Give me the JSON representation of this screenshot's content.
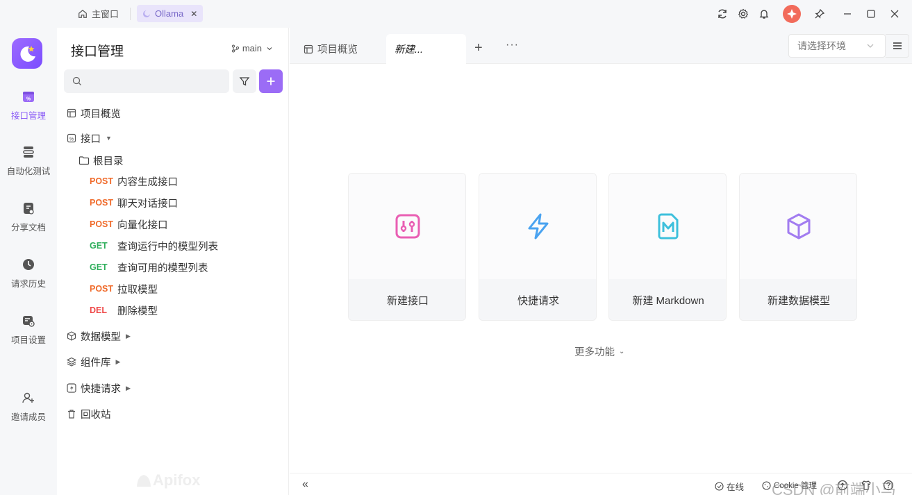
{
  "titlebar": {
    "home_tab": "主窗口",
    "project_tab": "Ollama",
    "close_glyph": "✕"
  },
  "iconbar": {
    "items": [
      {
        "label": "接口管理",
        "icon": "api-icon",
        "active": true
      },
      {
        "label": "自动化测试",
        "icon": "automation-icon",
        "active": false
      },
      {
        "label": "分享文档",
        "icon": "share-doc-icon",
        "active": false
      },
      {
        "label": "请求历史",
        "icon": "history-icon",
        "active": false
      },
      {
        "label": "项目设置",
        "icon": "project-settings-icon",
        "active": false
      },
      {
        "label": "邀请成员",
        "icon": "invite-member-icon",
        "active": false
      }
    ]
  },
  "tree": {
    "title": "接口管理",
    "branch": "main",
    "search": {
      "placeholder": "",
      "value": ""
    },
    "overview": "项目概览",
    "api_folder": "接口",
    "root_dir": "根目录",
    "endpoints": [
      {
        "method": "POST",
        "name": "内容生成接口"
      },
      {
        "method": "POST",
        "name": "聊天对话接口"
      },
      {
        "method": "POST",
        "name": "向量化接口"
      },
      {
        "method": "GET",
        "name": "查询运行中的模型列表"
      },
      {
        "method": "GET",
        "name": "查询可用的模型列表"
      },
      {
        "method": "POST",
        "name": "拉取模型"
      },
      {
        "method": "DEL",
        "name": "删除模型"
      }
    ],
    "data_model": "数据模型",
    "components": "组件库",
    "quick_request": "快捷请求",
    "recycle": "回收站",
    "watermark": "Apifox"
  },
  "main": {
    "tabs": {
      "overview": "项目概览",
      "new": "新建..."
    },
    "plus": "+",
    "more": "···",
    "env_select": {
      "placeholder": "请选择环境",
      "value": ""
    },
    "cards": [
      {
        "label": "新建接口",
        "icon": "new-api-icon",
        "color": "#e95fb3"
      },
      {
        "label": "快捷请求",
        "icon": "lightning-icon",
        "color": "#4aa3f0"
      },
      {
        "label": "新建 Markdown",
        "icon": "markdown-icon",
        "color": "#3ec0dc"
      },
      {
        "label": "新建数据模型",
        "icon": "cube-icon",
        "color": "#a27cf0"
      }
    ],
    "more_functions": "更多功能"
  },
  "statusbar": {
    "collapse": "«",
    "online": "在线",
    "cookie": "Cookie 管理",
    "watermark": "CSDN @前端小马"
  },
  "colors": {
    "accent": "#9b6cf6",
    "post": "#f06b2b",
    "get": "#2eae5b",
    "del": "#ef4949"
  }
}
